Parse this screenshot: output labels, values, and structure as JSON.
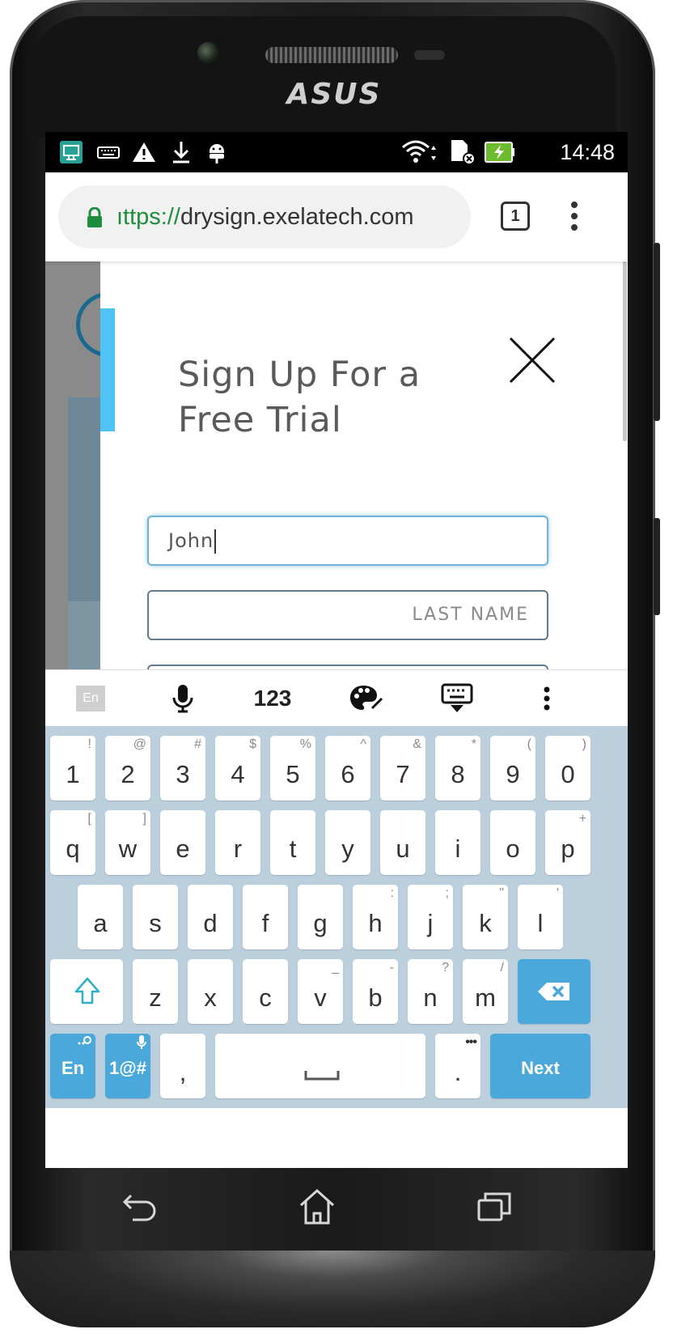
{
  "device": {
    "brand_logo": "ASUS"
  },
  "status_bar": {
    "left_icons": [
      "screen-cast-icon",
      "keyboard-icon",
      "warning-icon",
      "download-icon",
      "android-debug-icon"
    ],
    "right_icons": [
      "wifi-icon",
      "sd-card-icon",
      "battery-charging-icon"
    ],
    "time": "14:48"
  },
  "browser": {
    "url_scheme": "ıttps://",
    "url_host": "drysign.exelatech.com",
    "tab_count": "1"
  },
  "modal": {
    "title_line1": "Sign Up For a",
    "title_line2": "Free Trial",
    "first_name_value": "John",
    "last_name_placeholder": "LAST NAME"
  },
  "keyboard_toolbar": {
    "language": "En",
    "numbers": "123"
  },
  "keyboard": {
    "row1": [
      {
        "k": "1",
        "h": "!"
      },
      {
        "k": "2",
        "h": "@"
      },
      {
        "k": "3",
        "h": "#"
      },
      {
        "k": "4",
        "h": "$"
      },
      {
        "k": "5",
        "h": "%"
      },
      {
        "k": "6",
        "h": "^"
      },
      {
        "k": "7",
        "h": "&"
      },
      {
        "k": "8",
        "h": "*"
      },
      {
        "k": "9",
        "h": "("
      },
      {
        "k": "0",
        "h": ")"
      }
    ],
    "row2": [
      {
        "k": "q",
        "h": "["
      },
      {
        "k": "w",
        "h": "]"
      },
      {
        "k": "e",
        "h": ""
      },
      {
        "k": "r",
        "h": ""
      },
      {
        "k": "t",
        "h": ""
      },
      {
        "k": "y",
        "h": ""
      },
      {
        "k": "u",
        "h": ""
      },
      {
        "k": "i",
        "h": ""
      },
      {
        "k": "o",
        "h": ""
      },
      {
        "k": "p",
        "h": "+"
      }
    ],
    "row3": [
      {
        "k": "a",
        "h": ""
      },
      {
        "k": "s",
        "h": ""
      },
      {
        "k": "d",
        "h": ""
      },
      {
        "k": "f",
        "h": ""
      },
      {
        "k": "g",
        "h": ""
      },
      {
        "k": "h",
        "h": ":"
      },
      {
        "k": "j",
        "h": ";"
      },
      {
        "k": "k",
        "h": "\""
      },
      {
        "k": "l",
        "h": "'"
      }
    ],
    "row4": [
      {
        "k": "z",
        "h": ""
      },
      {
        "k": "x",
        "h": ""
      },
      {
        "k": "c",
        "h": ""
      },
      {
        "k": "v",
        "h": "_"
      },
      {
        "k": "b",
        "h": "-"
      },
      {
        "k": "n",
        "h": "?"
      },
      {
        "k": "m",
        "h": "/"
      }
    ],
    "lang_key": "En",
    "symbols_key": "1@#",
    "comma_key": ",",
    "period_key": ".",
    "next_key": "Next"
  },
  "colors": {
    "accent_blue": "#4aa9da",
    "keyboard_bg": "#bccfdc",
    "modal_accent": "#4fc3f7"
  }
}
